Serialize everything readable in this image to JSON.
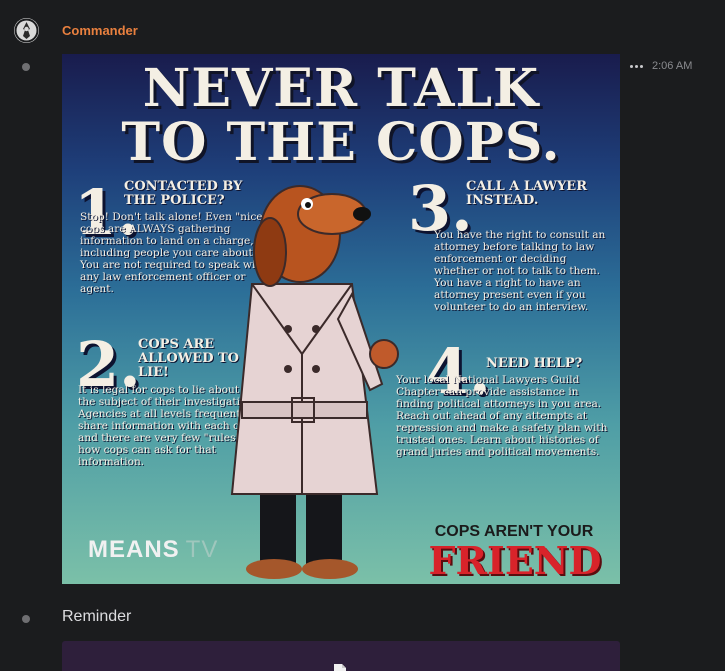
{
  "message": {
    "author": "Commander",
    "timestamp": "2:06 AM",
    "more_icon": "ellipsis-icon"
  },
  "poster": {
    "headline_line1": "NEVER TALK",
    "headline_line2": "TO THE COPS.",
    "sections": [
      {
        "number": "1.",
        "heading": "CONTACTED BY THE POLICE?",
        "body": "Stop! Don't talk alone! Even \"nice\" cops are ALWAYS gathering information to land on a charge, including people you care about. You are not required to speak with any law enforcement officer or agent."
      },
      {
        "number": "2.",
        "heading": "COPS ARE ALLOWED TO LIE!",
        "body": "It is legal for cops to lie about what the subject of their investigation is. Agencies at all levels frequently share information with each other and there are very few \"rules\" as to how cops can ask for that information."
      },
      {
        "number": "3.",
        "heading": "CALL A LAWYER INSTEAD.",
        "body": "You have the right to consult an attorney before talking to law enforcement or deciding whether or not to talk to them. You have a right to have an attorney present even if you volunteer to do an interview."
      },
      {
        "number": "4.",
        "heading": "NEED HELP?",
        "body": "Your local National Lawyers Guild Chapter can provide assistance in finding political attorneys in you area. Reach out ahead of any attempts at repression and make a safety plan with trusted ones. Learn about histories of grand juries and political movements."
      }
    ],
    "brand": "MEANS",
    "brand_suffix": "TV",
    "tagline": "COPS AREN'T YOUR",
    "tagline_big": "FRIEND"
  },
  "second_message": {
    "text": "Reminder",
    "attachment_icon": "file-icon"
  },
  "colors": {
    "author": "#e9803f",
    "background": "#1b1c1e",
    "attachment_bg": "#2e1f3b"
  }
}
